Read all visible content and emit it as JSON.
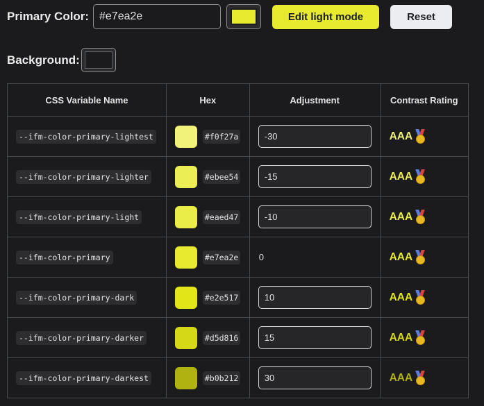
{
  "header": {
    "primary_label": "Primary Color:",
    "primary_value": "#e7ea2e",
    "primary_swatch_color": "#e7ea2e",
    "edit_button": "Edit light mode",
    "reset_button": "Reset",
    "background_label": "Background:",
    "background_swatch_color": "#1b1b1d"
  },
  "table": {
    "headers": [
      "CSS Variable Name",
      "Hex",
      "Adjustment",
      "Contrast Rating"
    ],
    "rows": [
      {
        "name": "--ifm-color-primary-lightest",
        "hex": "#f0f27a",
        "adjustment": "-30",
        "editable": true,
        "rating": "AAA"
      },
      {
        "name": "--ifm-color-primary-lighter",
        "hex": "#ebee54",
        "adjustment": "-15",
        "editable": true,
        "rating": "AAA"
      },
      {
        "name": "--ifm-color-primary-light",
        "hex": "#eaed47",
        "adjustment": "-10",
        "editable": true,
        "rating": "AAA"
      },
      {
        "name": "--ifm-color-primary",
        "hex": "#e7ea2e",
        "adjustment": "0",
        "editable": false,
        "rating": "AAA"
      },
      {
        "name": "--ifm-color-primary-dark",
        "hex": "#e2e517",
        "adjustment": "10",
        "editable": true,
        "rating": "AAA"
      },
      {
        "name": "--ifm-color-primary-darker",
        "hex": "#d5d816",
        "adjustment": "15",
        "editable": true,
        "rating": "AAA"
      },
      {
        "name": "--ifm-color-primary-darkest",
        "hex": "#b0b212",
        "adjustment": "30",
        "editable": true,
        "rating": "AAA"
      }
    ],
    "medal_icon": "medal-icon"
  }
}
